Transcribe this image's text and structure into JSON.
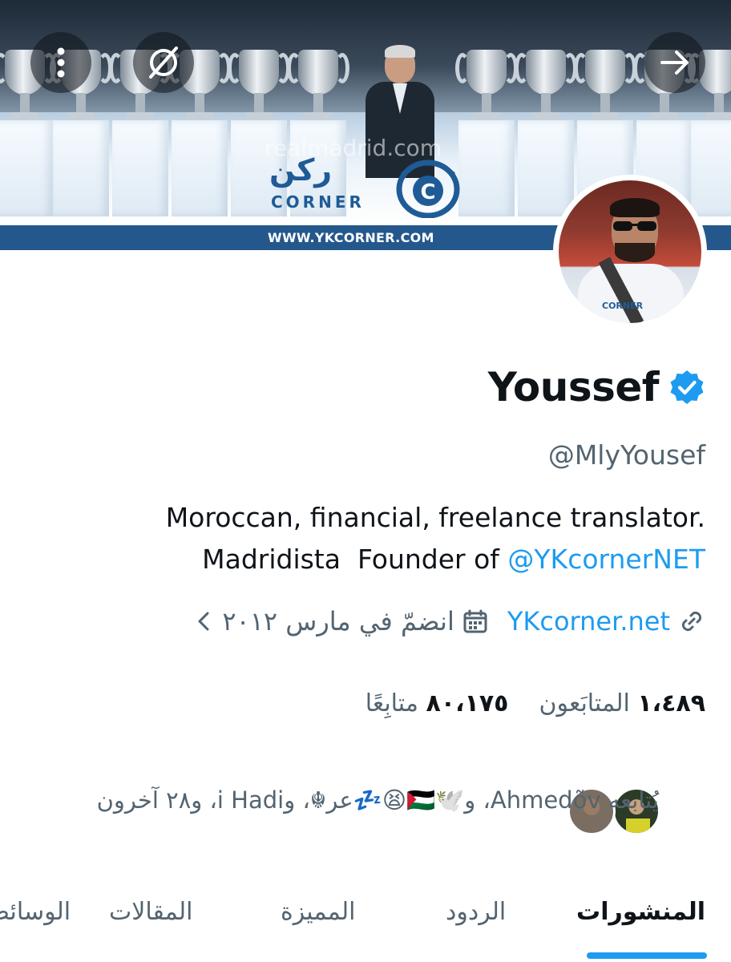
{
  "header": {
    "banner_watermark": "realmadrid.com",
    "banner_logo_arabic": "ركن",
    "banner_logo_text": "CORNER",
    "banner_url_text": "WWW.YKCORNER.COM",
    "back_icon": "arrow-left-icon",
    "grok_icon": "grok-icon",
    "more_icon": "more-vertical-icon"
  },
  "profile": {
    "display_name": "Youssef",
    "verified_icon": "verified-badge-icon",
    "verified_color": "#1d9bf0",
    "handle": "@MlyYousef",
    "bio_line1": "Moroccan, financial, freelance translator.",
    "bio_line2_prefix": "Madridista  Founder of ",
    "bio_mention": "@YKcornerNET",
    "website": "YKcorner.net",
    "joined": "انضمّ في مارس ٢٠١٢",
    "link_icon": "link-icon",
    "calendar_icon": "calendar-icon",
    "chevron_icon": "chevron-left-icon"
  },
  "stats": {
    "followers_count": "١،٤٨٩",
    "followers_label": "المتابَعون",
    "following_count": "٨٠،١٧٥",
    "following_label": "متابِعًا"
  },
  "followed_by": {
    "text": "يُتابعه Ahmedõv، و🕊️🇵🇸😫💤عر☬، وi Hadi، و٢٨ آخرون"
  },
  "tabs": [
    {
      "label": "المنشورات",
      "active": true
    },
    {
      "label": "الردود",
      "active": false
    },
    {
      "label": "المميزة",
      "active": false
    },
    {
      "label": "المقالات",
      "active": false
    },
    {
      "label": "الوسائط",
      "active": false
    }
  ],
  "colors": {
    "accent": "#1d9bf0",
    "text_primary": "#0f1419",
    "text_secondary": "#536471",
    "banner_blue": "#24588c"
  }
}
